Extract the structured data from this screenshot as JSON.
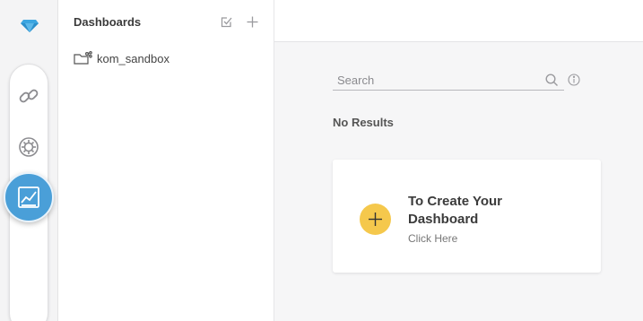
{
  "rail": {
    "logo_icon": "diamond-logo-icon",
    "items": [
      {
        "icon": "link-icon"
      },
      {
        "icon": "gear-cycle-icon"
      },
      {
        "icon": "chart-icon",
        "active": true
      }
    ],
    "accent_color": "#4a9fd8",
    "logo_color": "#3ba5e0"
  },
  "panel": {
    "title": "Dashboards",
    "header_icons": [
      "select-check-icon",
      "add-icon"
    ],
    "items": [
      {
        "label": "kom_sandbox",
        "icon": "shared-dashboard-icon"
      }
    ]
  },
  "search": {
    "value": "",
    "placeholder": "Search"
  },
  "results": {
    "status": "No Results"
  },
  "create_card": {
    "title": "To Create Your Dashboard",
    "subtitle": "Click Here",
    "plus_color": "#f5c84c"
  }
}
